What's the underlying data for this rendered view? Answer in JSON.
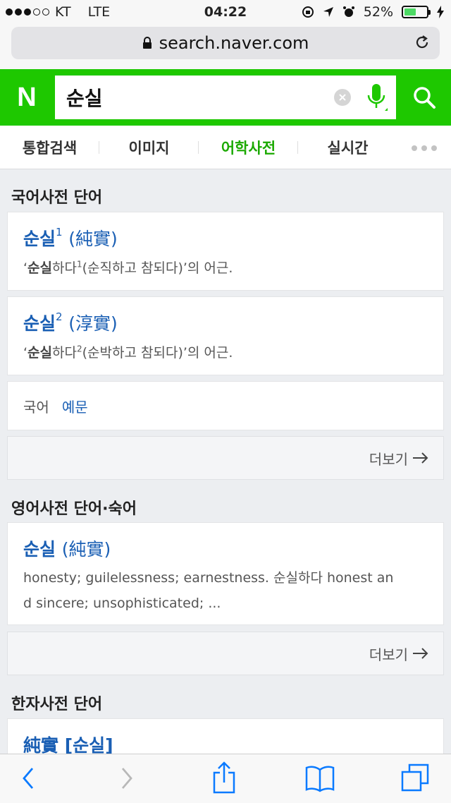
{
  "status_bar": {
    "carrier": "KT",
    "network": "LTE",
    "time": "04:22",
    "battery": "52%",
    "battery_level": 0.52
  },
  "browser": {
    "url": "search.naver.com"
  },
  "naver": {
    "logo": "N",
    "query": "순실"
  },
  "tabs": [
    {
      "label": "통합검색"
    },
    {
      "label": "이미지"
    },
    {
      "label": "어학사전"
    },
    {
      "label": "실시간"
    }
  ],
  "korean_dict": {
    "title": "국어사전 단어",
    "entries": [
      {
        "word": "순실",
        "num": "1",
        "hanja": "(純實)",
        "desc_quote_open": "‘",
        "desc_bold": "순실",
        "desc_mid": "하다",
        "desc_sup": "1",
        "desc_rest": "(순직하고 참되다)’의 어근."
      },
      {
        "word": "순실",
        "num": "2",
        "hanja": "(淳實)",
        "desc_quote_open": "‘",
        "desc_bold": "순실",
        "desc_mid": "하다",
        "desc_sup": "2",
        "desc_rest": "(순박하고 참되다)’의 어근."
      }
    ],
    "links": {
      "label": "국어",
      "example": "예문"
    },
    "more": "더보기"
  },
  "english_dict": {
    "title": "영어사전 단어·숙어",
    "entry": {
      "word": "순실",
      "hanja": "(純實)",
      "desc_line1": "honesty; guilelessness; earnestness. 순실하다 honest an",
      "desc_line2": "d sincere; unsophisticated; ..."
    },
    "more": "더보기"
  },
  "hanja_dict": {
    "title": "한자사전 단어",
    "entry": {
      "word": "純實 [순실]"
    }
  },
  "colors": {
    "naver_green": "#1ec800",
    "link_blue": "#1a5fb4",
    "active_tab": "#1ba900"
  },
  "icons": [
    "lock-icon",
    "reload-icon",
    "clear-icon",
    "mic-icon",
    "search-icon",
    "back-icon",
    "forward-icon",
    "share-icon",
    "bookmarks-icon",
    "tabs-icon"
  ]
}
